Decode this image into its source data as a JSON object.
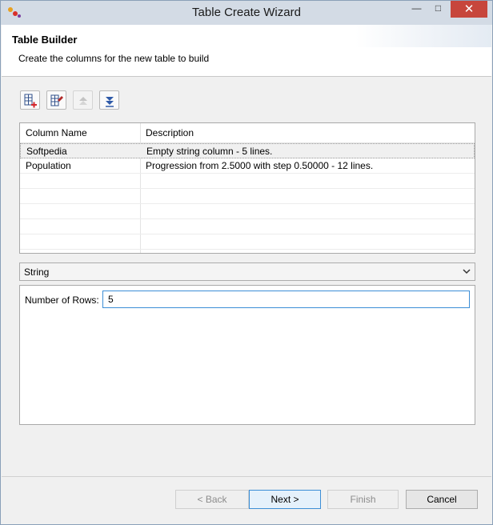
{
  "window": {
    "title": "Table Create Wizard",
    "close_glyph": "✕",
    "minimize_glyph": "—",
    "maximize_glyph": "□"
  },
  "header": {
    "title": "Table Builder",
    "description": "Create the columns for the new table to build"
  },
  "toolbar": {
    "buttons": [
      {
        "icon": "add-column-icon",
        "enabled": true
      },
      {
        "icon": "edit-column-icon",
        "enabled": true
      },
      {
        "icon": "move-up-icon",
        "enabled": false
      },
      {
        "icon": "move-down-icon",
        "enabled": true
      }
    ]
  },
  "table": {
    "columns": [
      "Column Name",
      "Description"
    ],
    "rows": [
      {
        "name": "Softpedia",
        "description": "Empty string column - 5 lines.",
        "selected": true
      },
      {
        "name": "Population",
        "description": "Progression from 2.5000 with step 0.50000 - 12 lines.",
        "selected": false
      }
    ]
  },
  "type_select": {
    "value": "String"
  },
  "details": {
    "rows_label": "Number of Rows:",
    "rows_value": "5"
  },
  "buttons": {
    "back": "< Back",
    "next": "Next >",
    "finish": "Finish",
    "cancel": "Cancel"
  },
  "colors": {
    "accent": "#3c8ed6",
    "close": "#c7463c",
    "titlebar": "#d3dbe5"
  }
}
